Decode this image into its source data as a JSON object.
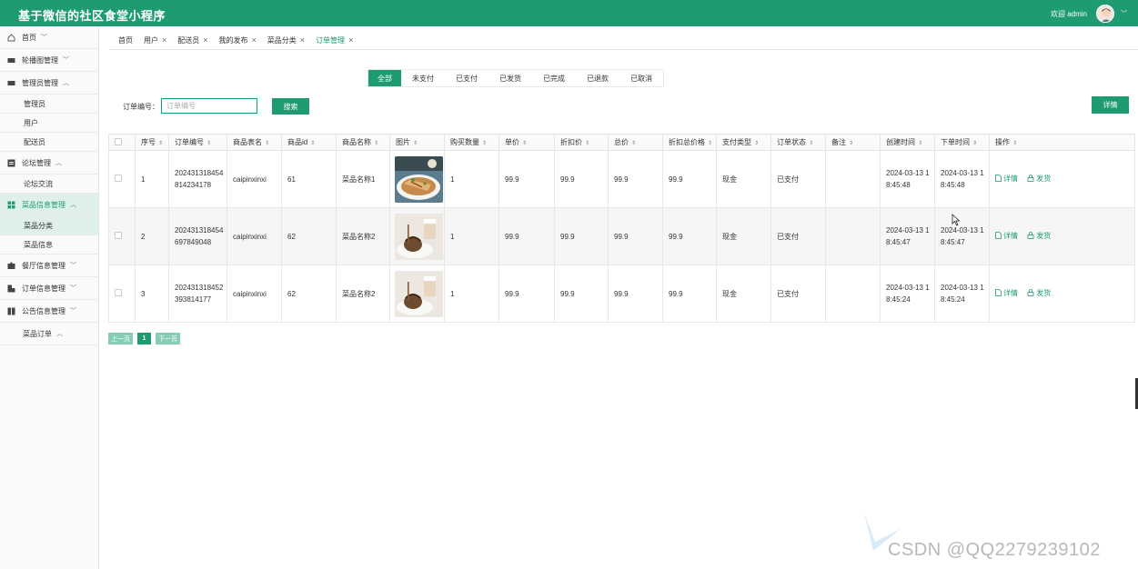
{
  "header": {
    "title": "基于微信的社区食堂小程序",
    "welcome": "欢迎 admin"
  },
  "sidebar": {
    "items": [
      {
        "label": "首页",
        "icon": "home-icon",
        "caret": "﹀"
      },
      {
        "label": "轮播图管理",
        "icon": "carousel-icon",
        "caret": "﹀"
      },
      {
        "label": "管理员管理",
        "icon": "admin-icon",
        "caret": "︿",
        "children": [
          "管理员",
          "用户",
          "配送员"
        ]
      },
      {
        "label": "论坛管理",
        "icon": "forum-icon",
        "caret": "︿",
        "children": [
          "论坛交流"
        ]
      },
      {
        "label": "菜品信息管理",
        "icon": "grid-icon",
        "caret": "︿",
        "children": [
          "菜品分类",
          "菜品信息"
        ]
      },
      {
        "label": "餐厅信息管理",
        "icon": "restaurant-icon",
        "caret": "﹀"
      },
      {
        "label": "订单信息管理",
        "icon": "order-icon",
        "caret": "﹀"
      },
      {
        "label": "公告信息管理",
        "icon": "notice-icon",
        "caret": "﹀"
      },
      {
        "label": "菜品订单",
        "icon": "",
        "caret": "︿"
      }
    ]
  },
  "tabs": [
    {
      "label": "首页",
      "closable": false
    },
    {
      "label": "用户",
      "closable": true
    },
    {
      "label": "配送员",
      "closable": true
    },
    {
      "label": "我的发布",
      "closable": true
    },
    {
      "label": "菜品分类",
      "closable": true
    },
    {
      "label": "订单管理",
      "closable": true,
      "active": true
    }
  ],
  "tab_close": "×",
  "status_filters": [
    "全部",
    "未支付",
    "已支付",
    "已发货",
    "已完成",
    "已退款",
    "已取消"
  ],
  "search": {
    "label": "订单编号：",
    "placeholder": "订单编号",
    "button": "搜索",
    "detail_button": "详情"
  },
  "table": {
    "headers": [
      "序号",
      "订单编号",
      "商品表名",
      "商品id",
      "商品名称",
      "图片",
      "购买数量",
      "单价",
      "折扣价",
      "总价",
      "折扣总价格",
      "支付类型",
      "订单状态",
      "备注",
      "创建时间",
      "下单时间",
      "操作"
    ],
    "sort_glyph": "⇕",
    "rows": [
      {
        "no": "1",
        "order_no": "202431318454814234178",
        "table": "caipinxinxi",
        "goods_id": "61",
        "name": "菜品名称1",
        "qty": "1",
        "price": "99.9",
        "discount": "99.9",
        "total": "99.9",
        "discount_total": "99.9",
        "pay_type": "现金",
        "status": "已支付",
        "note": "",
        "created": "2024-03-13 18:45:48",
        "ordered": "2024-03-13 18:45:48"
      },
      {
        "no": "2",
        "order_no": "202431318454697849048",
        "table": "caipinxinxi",
        "goods_id": "62",
        "name": "菜品名称2",
        "qty": "1",
        "price": "99.9",
        "discount": "99.9",
        "total": "99.9",
        "discount_total": "99.9",
        "pay_type": "现金",
        "status": "已支付",
        "note": "",
        "created": "2024-03-13 18:45:47",
        "ordered": "2024-03-13 18:45:47"
      },
      {
        "no": "3",
        "order_no": "202431318452393814177",
        "table": "caipinxinxi",
        "goods_id": "62",
        "name": "菜品名称2",
        "qty": "1",
        "price": "99.9",
        "discount": "99.9",
        "total": "99.9",
        "discount_total": "99.9",
        "pay_type": "现金",
        "status": "已支付",
        "note": "",
        "created": "2024-03-13 18:45:24",
        "ordered": "2024-03-13 18:45:24"
      }
    ],
    "actions": {
      "detail": "详情",
      "ship": "发货"
    }
  },
  "pagination": {
    "prev": "上一页",
    "current": "1",
    "next": "下一页"
  },
  "watermark": "CSDN @QQ2279239102",
  "colors": {
    "primary": "#1e9b72",
    "light": "#86cdb6",
    "active_bg": "#dff0ea"
  }
}
